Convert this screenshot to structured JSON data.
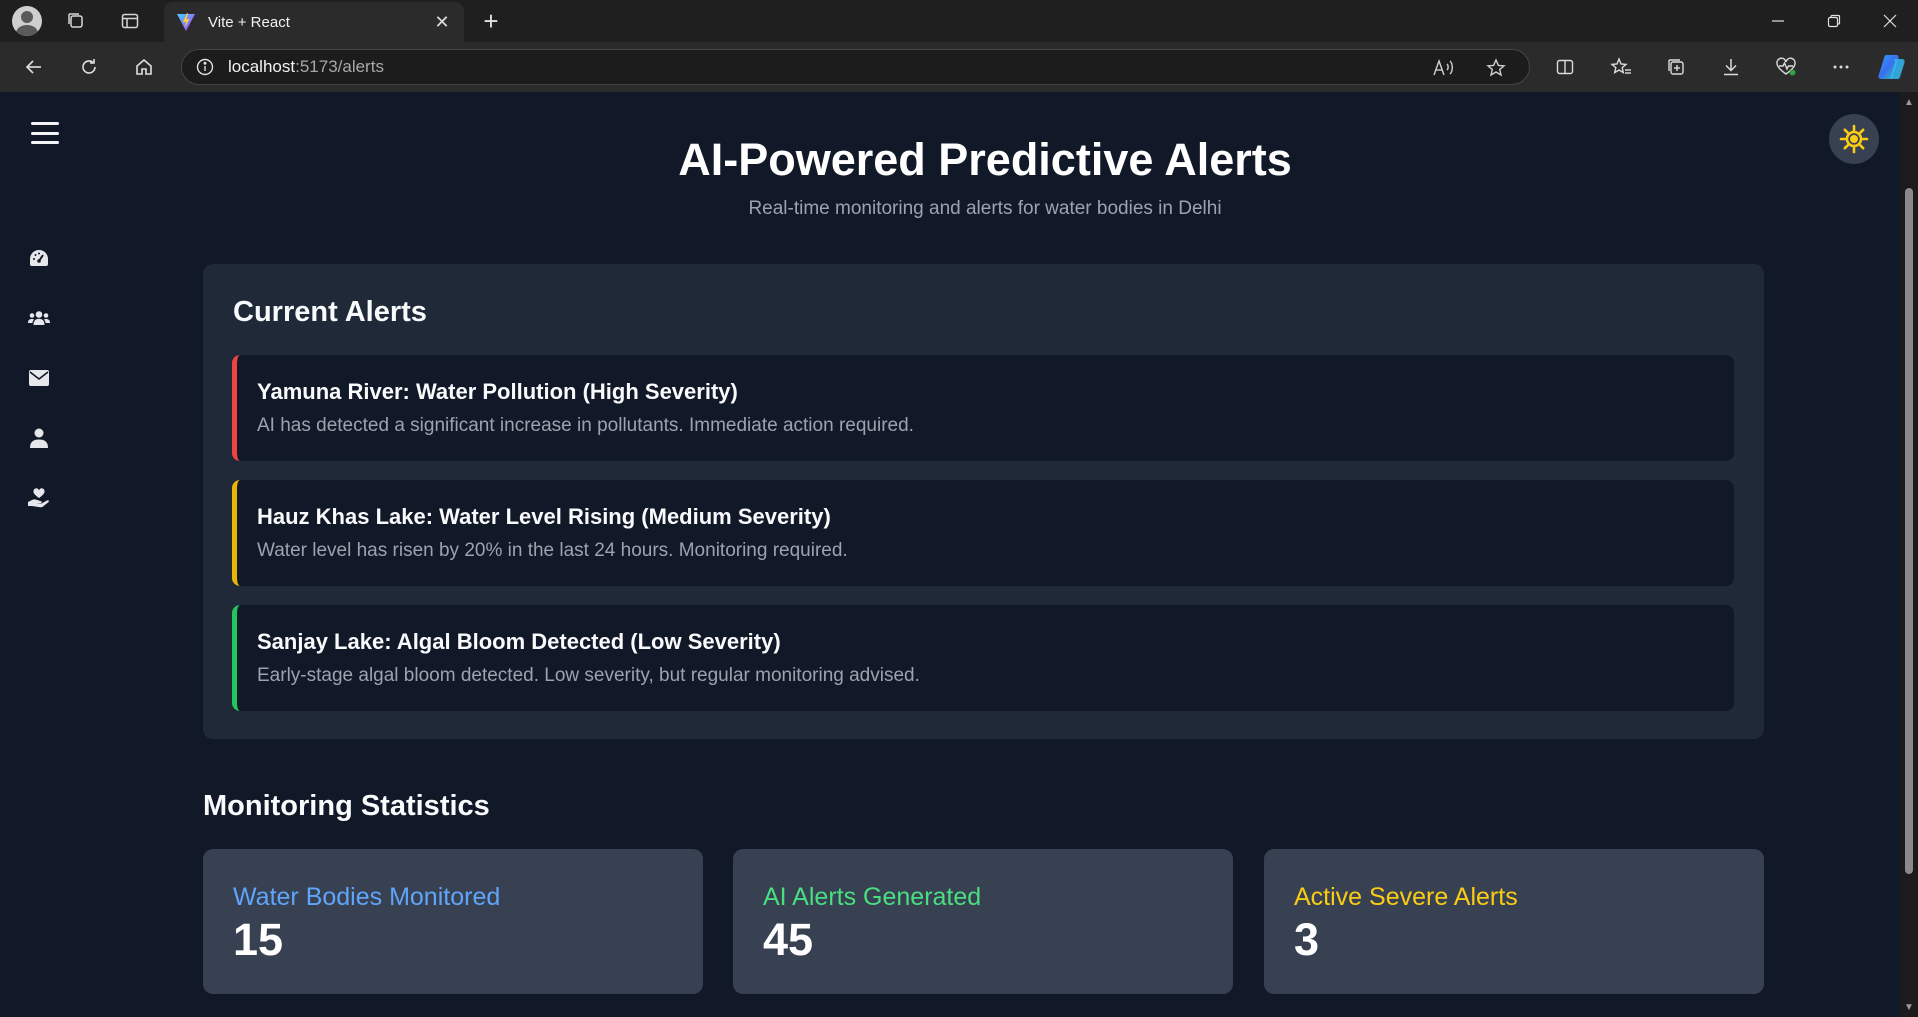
{
  "browser": {
    "tab_title": "Vite + React",
    "tab_close": "✕",
    "new_tab": "+",
    "url_host": "localhost",
    "url_path": ":5173/alerts"
  },
  "page": {
    "title": "AI-Powered Predictive Alerts",
    "subtitle": "Real-time monitoring and alerts for water bodies in Delhi"
  },
  "alerts_section": {
    "title": "Current Alerts",
    "alerts": [
      {
        "title": "Yamuna River: Water Pollution (High Severity)",
        "description": "AI has detected a significant increase in pollutants. Immediate action required.",
        "severity_color": "#ef4444"
      },
      {
        "title": "Hauz Khas Lake: Water Level Rising (Medium Severity)",
        "description": "Water level has risen by 20% in the last 24 hours. Monitoring required.",
        "severity_color": "#eab308"
      },
      {
        "title": "Sanjay Lake: Algal Bloom Detected (Low Severity)",
        "description": "Early-stage algal bloom detected. Low severity, but regular monitoring advised.",
        "severity_color": "#22c55e"
      }
    ]
  },
  "stats_section": {
    "title": "Monitoring Statistics",
    "stats": [
      {
        "label": "Water Bodies Monitored",
        "value": "15",
        "color": "#60a5fa"
      },
      {
        "label": "AI Alerts Generated",
        "value": "45",
        "color": "#4ade80"
      },
      {
        "label": "Active Severe Alerts",
        "value": "3",
        "color": "#facc15"
      }
    ]
  },
  "sidebar": {
    "icons": [
      "dashboard-icon",
      "users-icon",
      "envelope-icon",
      "user-icon",
      "hand-holding-heart-icon"
    ]
  },
  "theme_toggle_icon": "sun-icon"
}
